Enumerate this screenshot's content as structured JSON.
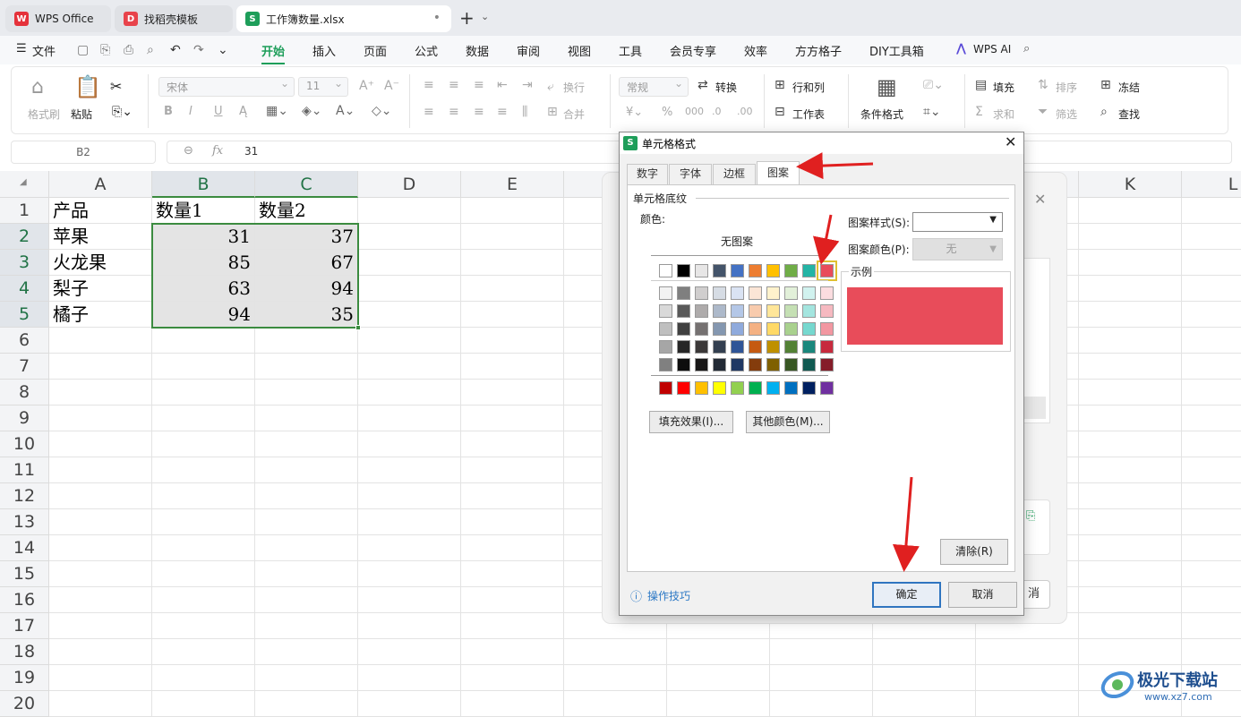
{
  "tabs": [
    {
      "label": "WPS Office"
    },
    {
      "label": "找稻壳模板"
    },
    {
      "label": "工作簿数量.xlsx"
    }
  ],
  "menu": {
    "file": "文件",
    "items": [
      "开始",
      "插入",
      "页面",
      "公式",
      "数据",
      "审阅",
      "视图",
      "工具",
      "会员专享",
      "效率",
      "方方格子",
      "DIY工具箱"
    ],
    "wps_ai": "WPS AI"
  },
  "ribbon": {
    "format_painter": "格式刷",
    "paste": "粘贴",
    "font_name": "宋体",
    "font_size": "11",
    "wrap": "换行",
    "merge": "合并",
    "number_format": "常规",
    "convert": "转换",
    "rows_cols": "行和列",
    "worksheet": "工作表",
    "cond_format": "条件格式",
    "fill": "填充",
    "sort": "排序",
    "freeze": "冻结",
    "sum": "求和",
    "filter": "筛选",
    "find": "查找"
  },
  "formula": {
    "cell_ref": "B2",
    "fx": "fx",
    "value": "31"
  },
  "columns": [
    "A",
    "B",
    "C",
    "D",
    "E",
    "F",
    "G",
    "H",
    "I",
    "J",
    "K",
    "L"
  ],
  "rows": [
    "1",
    "2",
    "3",
    "4",
    "5",
    "6",
    "7",
    "8",
    "9",
    "10",
    "11",
    "12",
    "13",
    "14",
    "15",
    "16",
    "17",
    "18",
    "19",
    "20"
  ],
  "cells": {
    "header": [
      "产品",
      "数量1",
      "数量2"
    ],
    "data": [
      [
        "苹果",
        "31",
        "37"
      ],
      [
        "火龙果",
        "85",
        "67"
      ],
      [
        "梨子",
        "63",
        "94"
      ],
      [
        "橘子",
        "94",
        "35"
      ]
    ]
  },
  "dialog": {
    "title": "单元格格式",
    "tabs": [
      "数字",
      "字体",
      "边框",
      "图案"
    ],
    "section": "单元格底纹",
    "color_label": "颜色:",
    "no_pattern": "无图案",
    "pattern_style_label": "图案样式(S):",
    "pattern_color_label": "图案颜色(P):",
    "pattern_color_value": "无",
    "sample_label": "示例",
    "sample_color": "#e84c5a",
    "fill_effects": "填充效果(I)...",
    "more_colors": "其他颜色(M)...",
    "clear": "清除(R)",
    "tips": "操作技巧",
    "ok": "确定",
    "cancel": "取消",
    "palette_top": [
      "#ffffff",
      "#000000",
      "#e7e6e6",
      "#44546a",
      "#4472c4",
      "#ed7d31",
      "#ffc000",
      "#70ad47",
      "#24b4a5",
      "#e84c5a"
    ],
    "palette_rows": [
      [
        "#f2f2f2",
        "#7f7f7f",
        "#d0cece",
        "#d6dce4",
        "#dae3f3",
        "#fbe5d6",
        "#fff2cc",
        "#e2f0d9",
        "#d1f2ef",
        "#fbdde0"
      ],
      [
        "#d9d9d9",
        "#595959",
        "#aeabab",
        "#adb9ca",
        "#b4c7e7",
        "#f8cbad",
        "#ffe699",
        "#c5e0b4",
        "#a4e5df",
        "#f6b9c0"
      ],
      [
        "#bfbfbf",
        "#404040",
        "#757171",
        "#8497b0",
        "#8faadc",
        "#f4b183",
        "#ffd966",
        "#a9d18e",
        "#76d8cf",
        "#f297a1"
      ],
      [
        "#a6a6a6",
        "#262626",
        "#3b3838",
        "#333f50",
        "#2f5597",
        "#c55a11",
        "#bf9000",
        "#538135",
        "#1a877c",
        "#c72a3d"
      ],
      [
        "#808080",
        "#0d0d0d",
        "#171616",
        "#222a35",
        "#1f3864",
        "#843c0c",
        "#7f6000",
        "#385723",
        "#115a52",
        "#851c29"
      ]
    ],
    "palette_std": [
      "#c00000",
      "#ff0000",
      "#ffc000",
      "#ffff00",
      "#92d050",
      "#00b050",
      "#00b0f0",
      "#0070c0",
      "#002060",
      "#7030a0"
    ]
  },
  "bg_panel": {
    "cancel_fragment": "消"
  },
  "watermark": {
    "text": "极光下载站",
    "url": "www.xz7.com"
  }
}
